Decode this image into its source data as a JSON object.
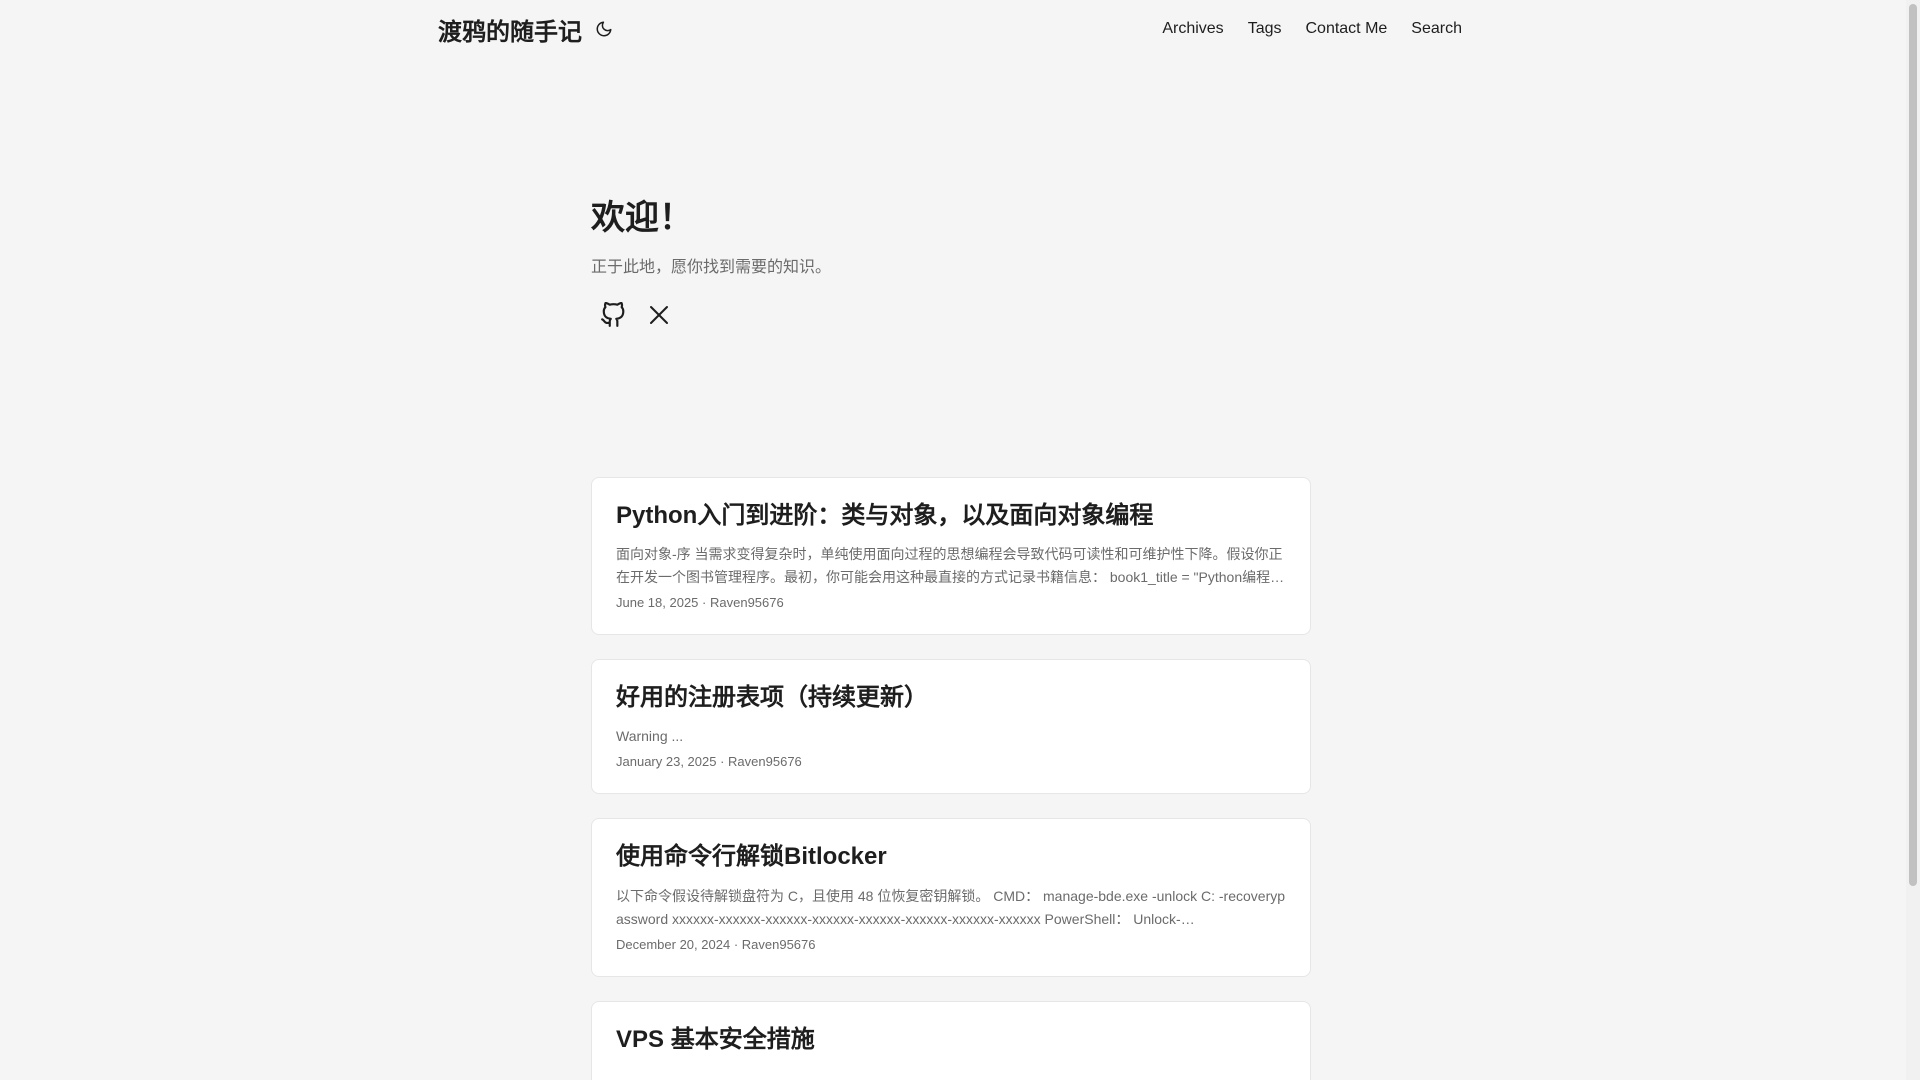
{
  "header": {
    "site_title": "渡鸦的随手记",
    "theme_icon": "moon-icon",
    "nav": [
      {
        "label": "Archives"
      },
      {
        "label": "Tags"
      },
      {
        "label": "Contact Me"
      },
      {
        "label": "Search"
      }
    ]
  },
  "home": {
    "title": "欢迎！",
    "subtitle": "正于此地，愿你找到需要的知识。",
    "social": [
      {
        "icon": "github-icon"
      },
      {
        "icon": "x-icon"
      }
    ]
  },
  "posts": [
    {
      "title": "Python入门到进阶：类与对象，以及面向对象编程",
      "excerpt": "面向对象-序 当需求变得复杂时，单纯使用面向过程的思想编程会导致代码可读性和可维护性下降。假设你正在开发一个图书管理程序。最初，你可能会用这种最直接的方式记录书籍信息： book1_title = \"Python编程…",
      "date": "June 18, 2025",
      "author": "Raven95676"
    },
    {
      "title": "好用的注册表项（持续更新）",
      "excerpt": "Warning ...",
      "date": "January 23, 2025",
      "author": "Raven95676"
    },
    {
      "title": "使用命令行解锁Bitlocker",
      "excerpt": "以下命令假设待解锁盘符为 C，且使用 48 位恢复密钥解锁。 CMD： manage-bde.exe -unlock C: -recoverypassword xxxxxx-xxxxxx-xxxxxx-xxxxxx-xxxxxx-xxxxxx-xxxxxx-xxxxxx PowerShell： Unlock-…",
      "date": "December 20, 2024",
      "author": "Raven95676"
    },
    {
      "title": "VPS 基本安全措施"
    }
  ],
  "meta_separator": "·",
  "colors": {
    "background": "#f5f5f5",
    "card": "#ffffff",
    "primary_text": "#1e1e1e",
    "secondary_text": "#6b6b6b"
  }
}
